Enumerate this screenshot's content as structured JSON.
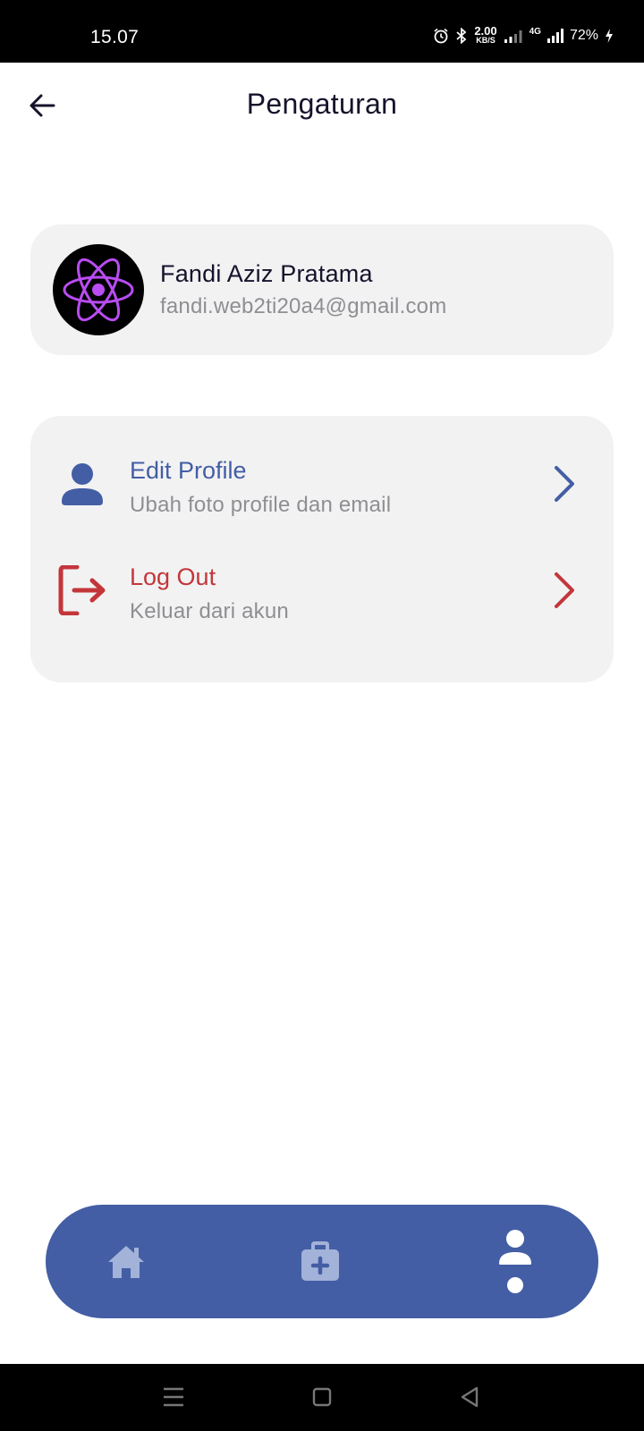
{
  "status_bar": {
    "time": "15.07",
    "speed_value": "2.00",
    "speed_unit": "KB/S",
    "network": "4G",
    "battery": "72%"
  },
  "header": {
    "title": "Pengaturan",
    "back_icon": "arrow-left-icon"
  },
  "profile": {
    "name": "Fandi Aziz Pratama",
    "email": "fandi.web2ti20a4@gmail.com",
    "avatar_icon": "react-atom-icon"
  },
  "menu": {
    "items": [
      {
        "title": "Edit Profile",
        "subtitle": "Ubah foto profile dan email",
        "icon": "user-icon",
        "color": "#435ea4"
      },
      {
        "title": "Log Out",
        "subtitle": "Keluar dari akun",
        "icon": "logout-icon",
        "color": "#c3363a"
      }
    ]
  },
  "bottom_nav": {
    "items": [
      {
        "name": "home",
        "icon": "home-icon",
        "active": false
      },
      {
        "name": "medical",
        "icon": "medical-kit-icon",
        "active": false
      },
      {
        "name": "profile",
        "icon": "user-icon",
        "active": true
      }
    ]
  },
  "colors": {
    "primary": "#435ea4",
    "danger": "#c3363a",
    "card_bg": "#f2f2f3",
    "avatar_accent": "#b94cf2"
  }
}
